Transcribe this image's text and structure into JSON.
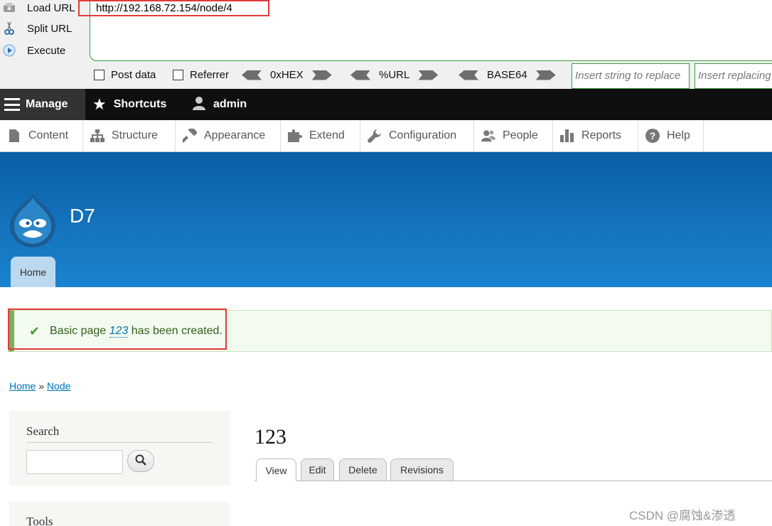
{
  "hackbar": {
    "actions": [
      {
        "label": "Load URL",
        "icon": "load-url-icon"
      },
      {
        "label": "Split URL",
        "icon": "split-url-icon"
      },
      {
        "label": "Execute",
        "icon": "execute-icon"
      }
    ],
    "url": "http://192.168.72.154/node/4",
    "checkboxes": [
      {
        "label": "Post data",
        "checked": false
      },
      {
        "label": "Referrer",
        "checked": false
      }
    ],
    "encoders": [
      "0xHEX",
      "%URL",
      "BASE64"
    ],
    "replace_placeholder": "Insert string to replace",
    "replacing_placeholder": "Insert replacing string"
  },
  "toolbar": {
    "manage": "Manage",
    "shortcuts": "Shortcuts",
    "user": "admin"
  },
  "tray": {
    "items": [
      {
        "label": "Content",
        "icon": "content-icon"
      },
      {
        "label": "Structure",
        "icon": "structure-icon"
      },
      {
        "label": "Appearance",
        "icon": "appearance-icon"
      },
      {
        "label": "Extend",
        "icon": "extend-icon"
      },
      {
        "label": "Configuration",
        "icon": "configuration-icon"
      },
      {
        "label": "People",
        "icon": "people-icon"
      },
      {
        "label": "Reports",
        "icon": "reports-icon"
      },
      {
        "label": "Help",
        "icon": "help-icon"
      }
    ]
  },
  "header": {
    "site_name": "D7",
    "home_tab": "Home",
    "colors": {
      "top": "#0b5fa6",
      "bottom": "#1b83cf"
    }
  },
  "message": {
    "prefix": "Basic page",
    "link": "123",
    "suffix": "has been created."
  },
  "breadcrumb": {
    "items": [
      "Home",
      "Node"
    ],
    "separator": "»"
  },
  "sidebar": {
    "search_title": "Search",
    "tools_title": "Tools"
  },
  "main": {
    "title": "123",
    "tabs": [
      "View",
      "Edit",
      "Delete",
      "Revisions"
    ],
    "active_tab": "View"
  },
  "watermark": "CSDN @腐蚀&渗透"
}
